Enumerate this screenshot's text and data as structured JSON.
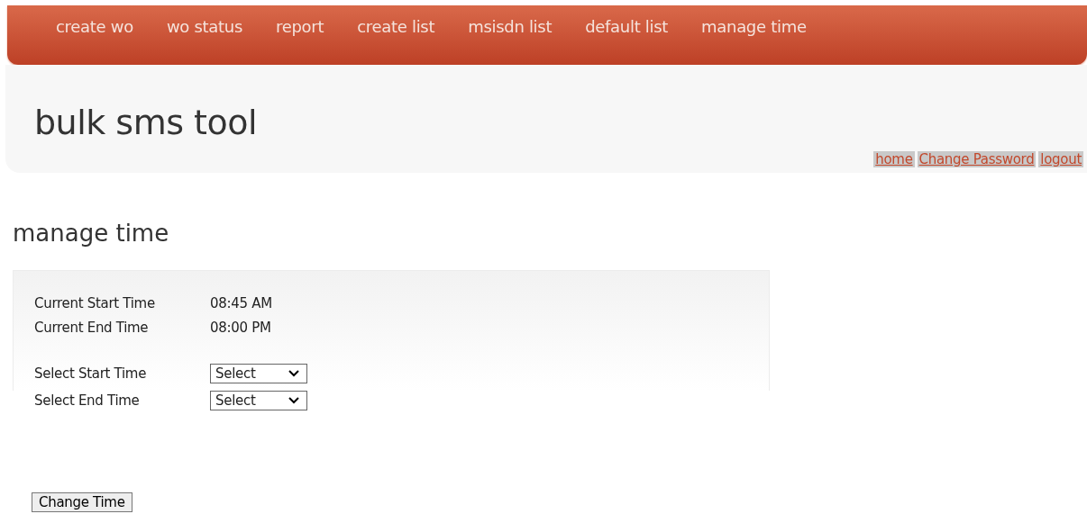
{
  "nav": [
    {
      "label": "create wo"
    },
    {
      "label": "wo status"
    },
    {
      "label": "report"
    },
    {
      "label": "create list"
    },
    {
      "label": "msisdn list"
    },
    {
      "label": "default list"
    },
    {
      "label": "manage time"
    }
  ],
  "header": {
    "title": "bulk sms tool",
    "links": [
      "home",
      "Change Password",
      "logout"
    ]
  },
  "heading": "manage time",
  "current": [
    {
      "label": "Current Start Time",
      "value": "08:45 AM"
    },
    {
      "label": "Current End Time",
      "value": "08:00 PM"
    }
  ],
  "selects": [
    {
      "label": "Select Start Time",
      "value": "Select"
    },
    {
      "label": "Select End Time",
      "value": "Select"
    }
  ],
  "button": "Change Time"
}
